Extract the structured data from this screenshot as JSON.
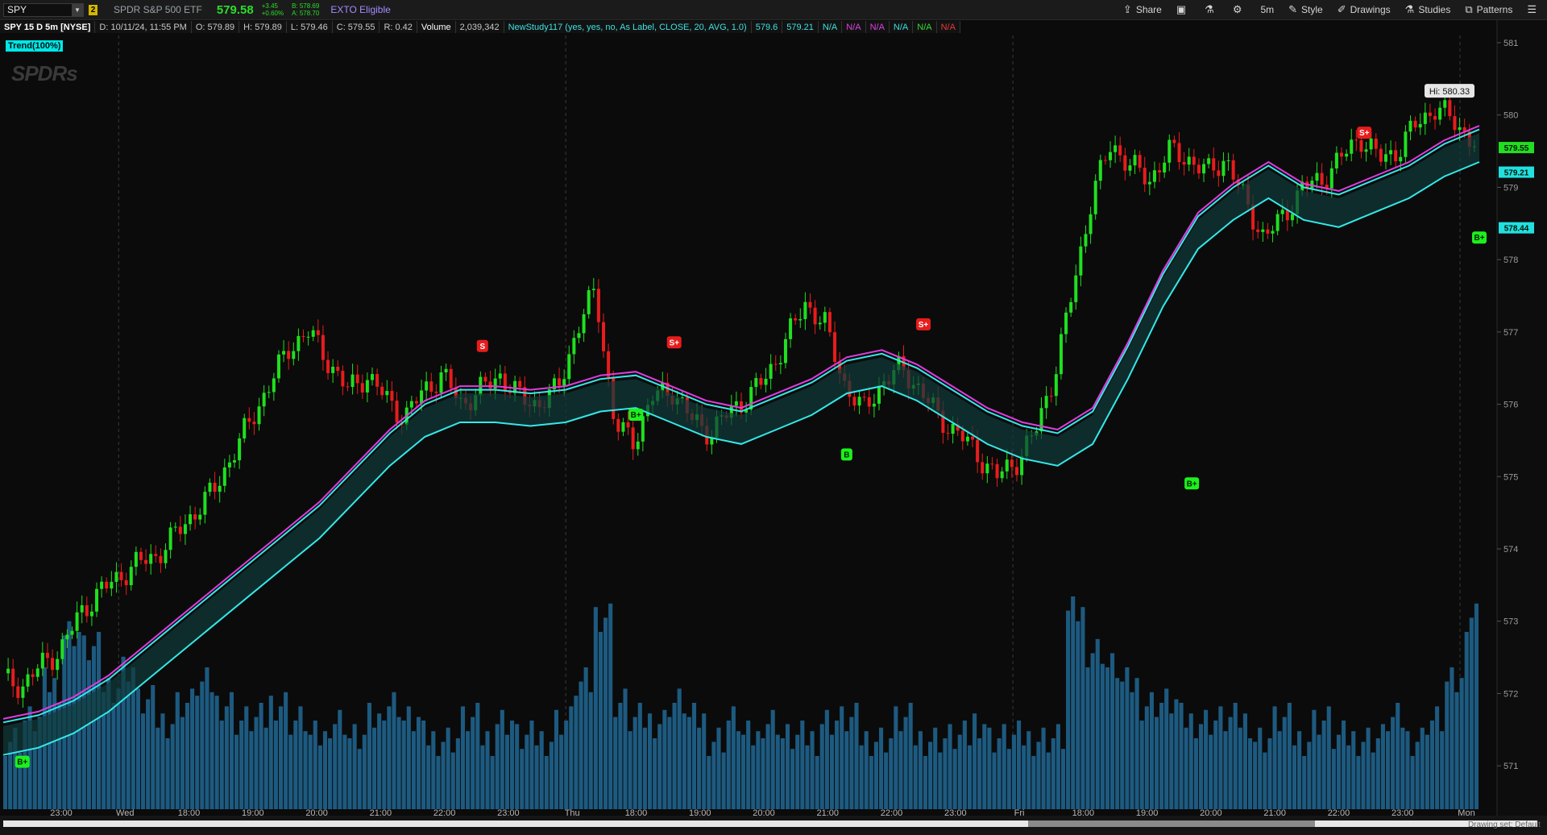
{
  "toolbar": {
    "symbol": "SPY",
    "link_number": "2",
    "description": "SPDR S&P 500 ETF",
    "last_price": "579.58",
    "change_abs": "+3.45",
    "change_pct": "+0.60%",
    "bid": "B: 578.69",
    "ask": "A: 578.70",
    "exto": "EXTO Eligible",
    "buttons": [
      {
        "label": "Share",
        "icon": "share-icon"
      },
      {
        "label": "",
        "icon": "camera-icon"
      },
      {
        "label": "",
        "icon": "flask-icon"
      },
      {
        "label": "",
        "icon": "gear-icon"
      },
      {
        "label": "5m",
        "icon": ""
      },
      {
        "label": "Style",
        "icon": "style-icon"
      },
      {
        "label": "Drawings",
        "icon": "drawings-icon"
      },
      {
        "label": "Studies",
        "icon": "studies-icon"
      },
      {
        "label": "Patterns",
        "icon": "patterns-icon"
      },
      {
        "label": "",
        "icon": "menu-icon"
      }
    ]
  },
  "info": {
    "title": "SPY 15 D 5m [NYSE]",
    "date": "D: 10/11/24, 11:55 PM",
    "open": "O: 579.89",
    "high": "H: 579.89",
    "low": "L: 579.46",
    "close": "C: 579.55",
    "range": "R: 0.42",
    "volume_label": "Volume",
    "volume_value": "2,039,342",
    "study": "NewStudy117 (yes, yes, no, As Label, CLOSE, 20, AVG, 1.0)",
    "study_v1": "579.6",
    "study_v2": "579.21",
    "na": [
      "N/A",
      "N/A",
      "N/A",
      "N/A",
      "N/A",
      "N/A"
    ]
  },
  "trend_badge": "Trend(100%)",
  "logo": "SPDRs",
  "drawing_set": "Drawing set: Default",
  "chart_data": {
    "type": "candlestick",
    "symbol": "SPY",
    "interval": "5m",
    "ylim": [
      570.4,
      581.1
    ],
    "y_ticks": [
      571,
      572,
      573,
      574,
      575,
      576,
      577,
      578,
      579,
      580,
      581
    ],
    "x_ticks": [
      "23:00",
      "Wed",
      "18:00",
      "19:00",
      "20:00",
      "21:00",
      "22:00",
      "23:00",
      "Thu",
      "18:00",
      "19:00",
      "20:00",
      "21:00",
      "22:00",
      "23:00",
      "Fri",
      "18:00",
      "19:00",
      "20:00",
      "21:00",
      "22:00",
      "23:00",
      "Mon"
    ],
    "day_separators": [
      "Wed",
      "Thu",
      "Fri",
      "Mon"
    ],
    "price_path": [
      572.2,
      572.1,
      572.4,
      572.6,
      573.1,
      573.4,
      573.6,
      573.8,
      573.9,
      574.2,
      574.5,
      574.8,
      575.3,
      575.8,
      576.3,
      576.8,
      577.0,
      576.6,
      576.2,
      576.4,
      576.1,
      575.8,
      576.2,
      576.4,
      576.0,
      576.2,
      576.4,
      576.1,
      576.0,
      576.2,
      577.0,
      577.6,
      575.7,
      575.5,
      576.1,
      576.2,
      575.8,
      575.6,
      575.9,
      576.1,
      576.4,
      576.9,
      577.4,
      577.1,
      576.3,
      575.9,
      576.3,
      576.5,
      576.2,
      575.8,
      575.6,
      575.3,
      575.0,
      575.2,
      575.6,
      576.4,
      577.6,
      578.9,
      579.6,
      579.3,
      579.1,
      579.5,
      579.4,
      579.2,
      579.4,
      578.8,
      578.3,
      578.6,
      579.0,
      579.1,
      579.4,
      579.7,
      579.4,
      579.5,
      579.9,
      580.1,
      579.9,
      579.6
    ],
    "hi_label": "Hi: 580.33",
    "price_labels": [
      {
        "value": 579.55,
        "text": "579.55",
        "color": "#22dd22"
      },
      {
        "value": 579.21,
        "text": "579.21",
        "color": "#22e0e0"
      },
      {
        "value": 578.44,
        "text": "578.44",
        "color": "#22e0e0"
      }
    ],
    "signals": [
      {
        "label": "B+",
        "index": 1,
        "price": 571.05,
        "kind": "buy"
      },
      {
        "label": "S",
        "index": 25,
        "price": 576.8,
        "kind": "sell"
      },
      {
        "label": "B+",
        "index": 33,
        "price": 575.85,
        "kind": "buy"
      },
      {
        "label": "S+",
        "index": 35,
        "price": 576.85,
        "kind": "sell"
      },
      {
        "label": "B",
        "index": 44,
        "price": 575.3,
        "kind": "buy"
      },
      {
        "label": "S+",
        "index": 48,
        "price": 577.1,
        "kind": "sell"
      },
      {
        "label": "B+",
        "index": 62,
        "price": 574.9,
        "kind": "buy"
      },
      {
        "label": "S+",
        "index": 71,
        "price": 579.75,
        "kind": "sell"
      },
      {
        "label": "B+",
        "index": 77,
        "price": 578.3,
        "kind": "buy"
      }
    ],
    "series": [
      {
        "values": [
          571.6,
          571.7,
          571.9,
          572.2,
          572.6,
          573.0,
          573.4,
          573.8,
          574.2,
          574.6,
          575.1,
          575.6,
          576.0,
          576.2,
          576.2,
          576.15,
          576.2,
          576.35,
          576.4,
          576.2,
          576.0,
          575.9,
          576.1,
          576.3,
          576.6,
          576.7,
          576.5,
          576.2,
          575.9,
          575.7,
          575.6,
          575.9,
          576.8,
          577.8,
          578.6,
          579.0,
          579.3,
          579.0,
          578.9,
          579.1,
          579.3,
          579.6,
          579.8
        ],
        "color": "#35e8e8"
      },
      {
        "values": [
          571.6,
          571.7,
          571.9,
          572.2,
          572.6,
          573.0,
          573.4,
          573.8,
          574.2,
          574.6,
          575.1,
          575.6,
          576.0,
          576.2,
          576.2,
          576.15,
          576.2,
          576.35,
          576.4,
          576.2,
          576.0,
          575.9,
          576.1,
          576.3,
          576.6,
          576.7,
          576.5,
          576.2,
          575.9,
          575.7,
          575.6,
          575.9,
          576.8,
          577.8,
          578.6,
          579.0,
          579.3,
          579.0,
          578.9,
          579.1,
          579.3,
          579.6,
          579.8
        ],
        "color": "#e03ce0"
      }
    ],
    "volume_profile": [
      3,
      4,
      6,
      9,
      8,
      6,
      7,
      5,
      4,
      5,
      6,
      5,
      4,
      4,
      5,
      4,
      3,
      4,
      3,
      4,
      5,
      4,
      3,
      3,
      4,
      3,
      4,
      3,
      3,
      4,
      6,
      10,
      5,
      4,
      4,
      5,
      4,
      3,
      4,
      3,
      4,
      3,
      3,
      4,
      4,
      3,
      3,
      4,
      3,
      3,
      3,
      4,
      3,
      3,
      3,
      3,
      10,
      8,
      7,
      6,
      5,
      5,
      4,
      4,
      4,
      4,
      3,
      4,
      3,
      4,
      3,
      3,
      3,
      4,
      3,
      4,
      6,
      10
    ]
  }
}
